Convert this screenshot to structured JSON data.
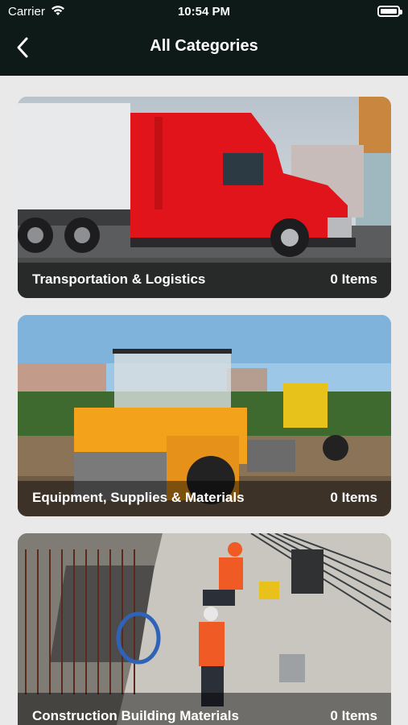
{
  "status_bar": {
    "carrier": "Carrier",
    "time": "10:54 PM"
  },
  "header": {
    "title": "All Categories"
  },
  "categories": [
    {
      "name": "Transportation & Logistics",
      "count": "0 Items"
    },
    {
      "name": "Equipment, Supplies & Materials",
      "count": "0 Items"
    },
    {
      "name": "Construction Building Materials",
      "count": "0 Items"
    }
  ],
  "colors": {
    "header_bg": "#0e1a17",
    "page_bg": "#e9e9e9",
    "truck_red": "#e0141a",
    "machine_yellow": "#f2a31b"
  }
}
